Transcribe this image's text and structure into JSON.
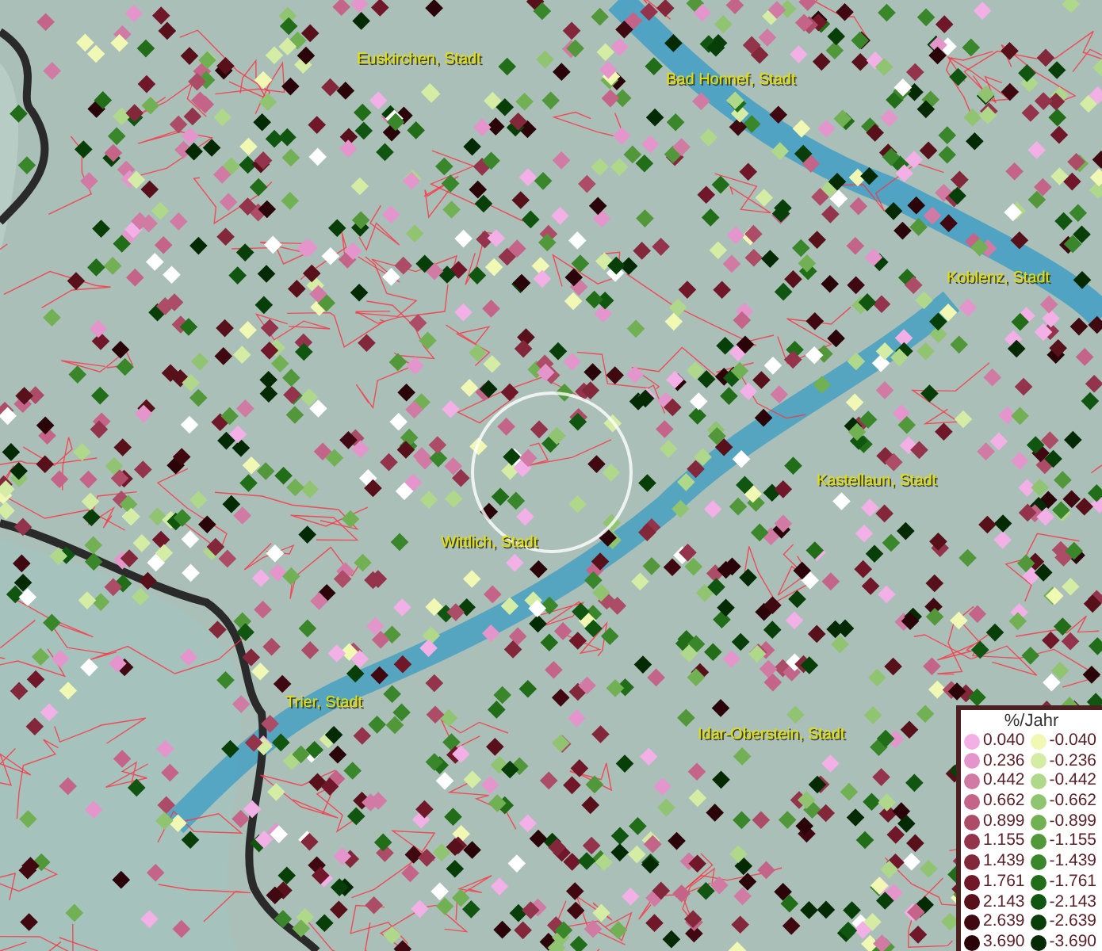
{
  "map": {
    "places": [
      {
        "label": "Euskirchen, Stadt"
      },
      {
        "label": "Bad Honnef, Stadt"
      },
      {
        "label": "Koblenz, Stadt"
      },
      {
        "label": "Kastellaun, Stadt"
      },
      {
        "label": "Wittlich, Stadt"
      },
      {
        "label": "Trier, Stadt"
      },
      {
        "label": "Idar-Oberstein, Stadt"
      }
    ]
  },
  "legend": {
    "title": "%/Jahr",
    "rows": [
      {
        "positive": {
          "label": "0.040",
          "color": "#f2b0e6"
        },
        "negative": {
          "label": "-0.040",
          "color": "#f0f8b4"
        }
      },
      {
        "positive": {
          "label": "0.236",
          "color": "#e496cc"
        },
        "negative": {
          "label": "-0.236",
          "color": "#d4eca4"
        }
      },
      {
        "positive": {
          "label": "0.442",
          "color": "#d07aa4"
        },
        "negative": {
          "label": "-0.442",
          "color": "#b0d88a"
        }
      },
      {
        "positive": {
          "label": "0.662",
          "color": "#c46488"
        },
        "negative": {
          "label": "-0.662",
          "color": "#90c470"
        }
      },
      {
        "positive": {
          "label": "0.899",
          "color": "#ac4c66"
        },
        "negative": {
          "label": "-0.899",
          "color": "#72b054"
        }
      },
      {
        "positive": {
          "label": "1.155",
          "color": "#94344c"
        },
        "negative": {
          "label": "-1.155",
          "color": "#52983a"
        }
      },
      {
        "positive": {
          "label": "1.439",
          "color": "#82283a"
        },
        "negative": {
          "label": "-1.439",
          "color": "#3a862a"
        }
      },
      {
        "positive": {
          "label": "1.761",
          "color": "#70182a"
        },
        "negative": {
          "label": "-1.761",
          "color": "#226e18"
        }
      },
      {
        "positive": {
          "label": "2.143",
          "color": "#58101a"
        },
        "negative": {
          "label": "-2.143",
          "color": "#105610"
        }
      },
      {
        "positive": {
          "label": "2.639",
          "color": "#400810"
        },
        "negative": {
          "label": "-2.639",
          "color": "#083e08"
        }
      },
      {
        "positive": {
          "label": "3.690",
          "color": "#2a0408"
        },
        "negative": {
          "label": "-3.690",
          "color": "#042a04"
        }
      }
    ]
  }
}
